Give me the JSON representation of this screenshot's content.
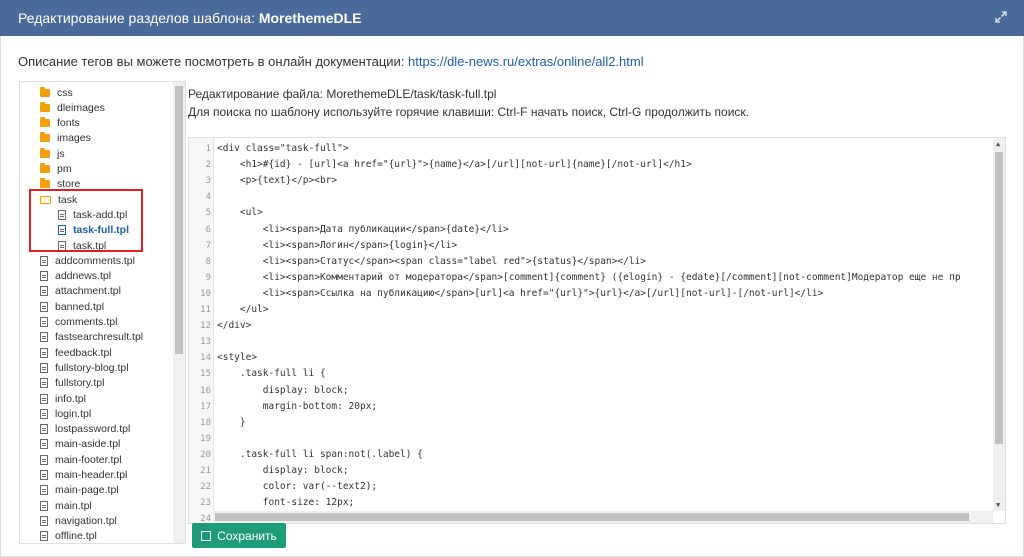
{
  "header": {
    "title_prefix": "Редактирование разделов шаблона: ",
    "title_name": "MorethemeDLE",
    "expand_icon": "expand-icon"
  },
  "description": {
    "text": "Описание тегов вы можете посмотреть в онлайн документации: ",
    "link": "https://dle-news.ru/extras/online/all2.html"
  },
  "tree": {
    "items": [
      {
        "label": "css",
        "icon": "folder-icon"
      },
      {
        "label": "dleimages",
        "icon": "folder-icon"
      },
      {
        "label": "fonts",
        "icon": "folder-icon"
      },
      {
        "label": "images",
        "icon": "folder-icon"
      },
      {
        "label": "js",
        "icon": "folder-icon"
      },
      {
        "label": "pm",
        "icon": "folder-icon"
      },
      {
        "label": "store",
        "icon": "folder-icon"
      },
      {
        "label": "task",
        "icon": "open-folder-icon"
      },
      {
        "label": "task-add.tpl",
        "icon": "file-icon"
      },
      {
        "label": "task-full.tpl",
        "icon": "file-icon"
      },
      {
        "label": "task.tpl",
        "icon": "file-icon"
      },
      {
        "label": "addcomments.tpl",
        "icon": "file-icon"
      },
      {
        "label": "addnews.tpl",
        "icon": "file-icon"
      },
      {
        "label": "attachment.tpl",
        "icon": "file-icon"
      },
      {
        "label": "banned.tpl",
        "icon": "file-icon"
      },
      {
        "label": "comments.tpl",
        "icon": "file-icon"
      },
      {
        "label": "fastsearchresult.tpl",
        "icon": "file-icon"
      },
      {
        "label": "feedback.tpl",
        "icon": "file-icon"
      },
      {
        "label": "fullstory-blog.tpl",
        "icon": "file-icon"
      },
      {
        "label": "fullstory.tpl",
        "icon": "file-icon"
      },
      {
        "label": "info.tpl",
        "icon": "file-icon"
      },
      {
        "label": "login.tpl",
        "icon": "file-icon"
      },
      {
        "label": "lostpassword.tpl",
        "icon": "file-icon"
      },
      {
        "label": "main-aside.tpl",
        "icon": "file-icon"
      },
      {
        "label": "main-footer.tpl",
        "icon": "file-icon"
      },
      {
        "label": "main-header.tpl",
        "icon": "file-icon"
      },
      {
        "label": "main-page.tpl",
        "icon": "file-icon"
      },
      {
        "label": "main.tpl",
        "icon": "file-icon"
      },
      {
        "label": "navigation.tpl",
        "icon": "file-icon"
      },
      {
        "label": "offline.tpl",
        "icon": "file-icon"
      }
    ],
    "active_index": 9
  },
  "editor": {
    "file_label": "Редактирование файла: MorethemeDLE/task/task-full.tpl",
    "hint": "Для поиска по шаблону используйте горячие клавиши: Ctrl-F начать поиск, Ctrl-G продолжить поиск.",
    "lines": [
      {
        "n": "1",
        "text": "<div class=\"task-full\">"
      },
      {
        "n": "2",
        "text": "    <h1>#{id} - [url]<a href=\"{url}\">{name}</a>[/url][not-url]{name}[/not-url]</h1>"
      },
      {
        "n": "3",
        "text": "    <p>{text}</p><br>"
      },
      {
        "n": "4",
        "text": ""
      },
      {
        "n": "5",
        "text": "    <ul>"
      },
      {
        "n": "6",
        "text": "        <li><span>Дата публикации</span>{date}</li>"
      },
      {
        "n": "7",
        "text": "        <li><span>Логин</span>{login}</li>"
      },
      {
        "n": "8",
        "text": "        <li><span>Статус</span><span class=\"label red\">{status}</span></li>"
      },
      {
        "n": "9",
        "text": "        <li><span>Комментарий от модератора</span>[comment]{comment} ({elogin} - {edate}[/comment][not-comment]Модератор еще не пр"
      },
      {
        "n": "10",
        "text": "        <li><span>Ссылка на публикацию</span>[url]<a href=\"{url}\">{url}</a>[/url][not-url]-[/not-url]</li>"
      },
      {
        "n": "11",
        "text": "    </ul>"
      },
      {
        "n": "12",
        "text": "</div>"
      },
      {
        "n": "13",
        "text": ""
      },
      {
        "n": "14",
        "text": "<style>"
      },
      {
        "n": "15",
        "text": "    .task-full li {"
      },
      {
        "n": "16",
        "text": "        display: block;"
      },
      {
        "n": "17",
        "text": "        margin-bottom: 20px;"
      },
      {
        "n": "18",
        "text": "    }"
      },
      {
        "n": "19",
        "text": ""
      },
      {
        "n": "20",
        "text": "    .task-full li span:not(.label) {"
      },
      {
        "n": "21",
        "text": "        display: block;"
      },
      {
        "n": "22",
        "text": "        color: var(--text2);"
      },
      {
        "n": "23",
        "text": "        font-size: 12px;"
      },
      {
        "n": "24",
        "text": ""
      }
    ]
  },
  "save_button": {
    "label": "Сохранить",
    "icon": "save-icon"
  },
  "colors": {
    "header_bg": "#4a6b9a",
    "link": "#1e5fa8",
    "save_bg": "#1e9c7a",
    "highlight": "#e02020",
    "folder": "#f1a00c"
  }
}
